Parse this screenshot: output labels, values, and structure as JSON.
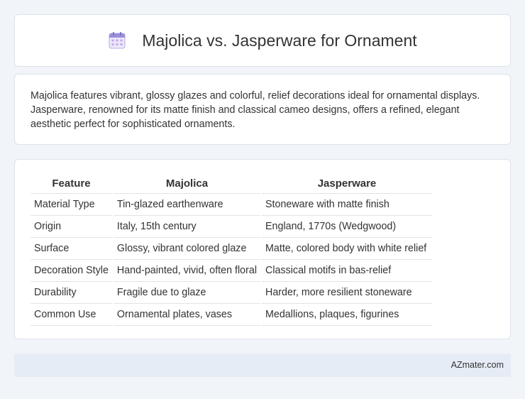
{
  "header": {
    "icon": "calendar-icon",
    "title": "Majolica vs. Jasperware for Ornament"
  },
  "summary": {
    "text": "Majolica features vibrant, glossy glazes and colorful, relief decorations ideal for ornamental displays. Jasperware, renowned for its matte finish and classical cameo designs, offers a refined, elegant aesthetic perfect for sophisticated ornaments."
  },
  "table": {
    "headers": [
      "Feature",
      "Majolica",
      "Jasperware"
    ],
    "rows": [
      [
        "Material Type",
        "Tin-glazed earthenware",
        "Stoneware with matte finish"
      ],
      [
        "Origin",
        "Italy, 15th century",
        "England, 1770s (Wedgwood)"
      ],
      [
        "Surface",
        "Glossy, vibrant colored glaze",
        "Matte, colored body with white relief"
      ],
      [
        "Decoration Style",
        "Hand-painted, vivid, often floral",
        "Classical motifs in bas-relief"
      ],
      [
        "Durability",
        "Fragile due to glaze",
        "Harder, more resilient stoneware"
      ],
      [
        "Common Use",
        "Ornamental plates, vases",
        "Medallions, plaques, figurines"
      ]
    ]
  },
  "footer": {
    "brand": "AZmater.com"
  },
  "colors": {
    "background": "#f1f4f9",
    "card": "#ffffff",
    "footer": "#e6ecf6",
    "icon_accent": "#9b8fd9"
  }
}
